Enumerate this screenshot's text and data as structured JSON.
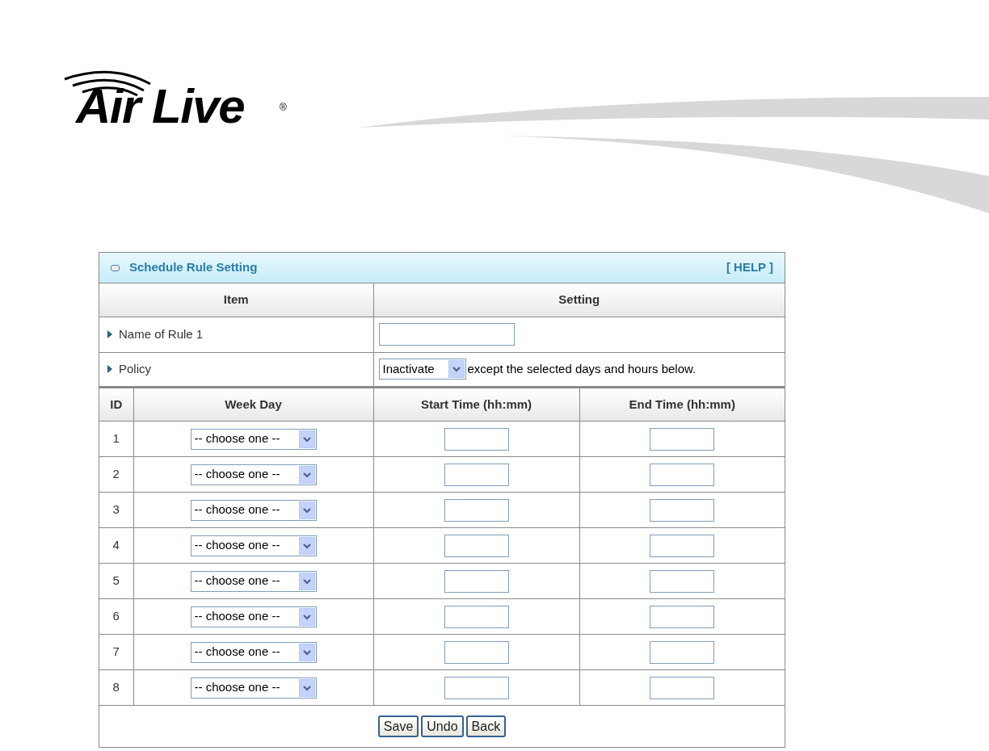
{
  "logo": {
    "text": "Air Live",
    "mark": "®"
  },
  "panel": {
    "title": "Schedule Rule Setting",
    "help": "[ HELP ]"
  },
  "settings": {
    "columns": [
      "Item",
      "Setting"
    ],
    "name_row": {
      "label": "Name of Rule 1"
    },
    "policy_row": {
      "label": "Policy",
      "select": "Inactivate",
      "note": "except the selected days and hours below."
    }
  },
  "schedule": {
    "columns": [
      "ID",
      "Week Day",
      "Start Time (hh:mm)",
      "End Time (hh:mm)"
    ],
    "rows": [
      {
        "id": "1",
        "weekday": "-- choose one --"
      },
      {
        "id": "2",
        "weekday": "-- choose one --"
      },
      {
        "id": "3",
        "weekday": "-- choose one --"
      },
      {
        "id": "4",
        "weekday": "-- choose one --"
      },
      {
        "id": "5",
        "weekday": "-- choose one --"
      },
      {
        "id": "6",
        "weekday": "-- choose one --"
      },
      {
        "id": "7",
        "weekday": "-- choose one --"
      },
      {
        "id": "8",
        "weekday": "-- choose one --"
      }
    ]
  },
  "buttons": [
    "Save",
    "Undo",
    "Back"
  ]
}
